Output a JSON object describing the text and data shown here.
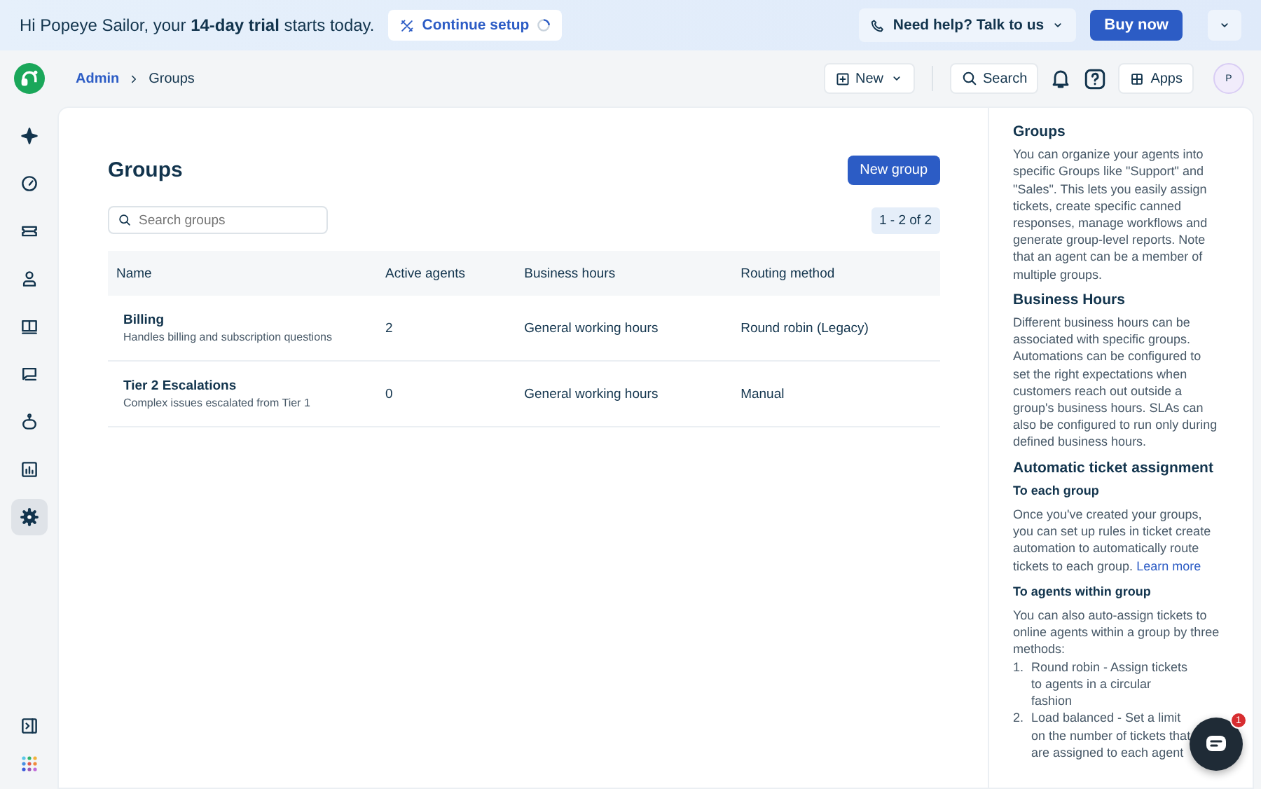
{
  "banner": {
    "greeting": "Hi Popeye Sailor, your **14-day trial** starts today.",
    "setup_button": "Continue setup",
    "help_button": "Need help? Talk to us",
    "buy_button": "Buy now"
  },
  "breadcrumb": {
    "parent": "Admin",
    "current": "Groups"
  },
  "header_actions": {
    "new_button": "New",
    "search_button": "Search",
    "apps_button": "Apps",
    "avatar": "P"
  },
  "sidebar": {
    "items": [
      {
        "selected": false
      },
      {
        "selected": false
      },
      {
        "selected": false
      },
      {
        "selected": false
      },
      {
        "selected": false
      },
      {
        "selected": false
      },
      {
        "selected": false
      },
      {
        "selected": false
      },
      {
        "selected": true
      }
    ]
  },
  "page": {
    "title": "Groups",
    "new_group_button": "New group",
    "search": {
      "placeholder": "Search groups"
    },
    "pagination": "1 - 2 of 2"
  },
  "table": {
    "columns": [
      "Name",
      "Active agents",
      "Business hours",
      "Routing method"
    ],
    "rows": [
      {
        "name": "Billing",
        "description": "Handles billing and subscription questions",
        "active_agents": "2",
        "business_hours": "General working hours",
        "routing_method": "Round robin (Legacy)"
      },
      {
        "name": "Tier 2 Escalations",
        "description": "Complex issues escalated from Tier 1",
        "active_agents": "0",
        "business_hours": "General working hours",
        "routing_method": "Manual"
      }
    ]
  },
  "help_panel": {
    "sections": [
      {
        "kind": "heading",
        "text": "Groups"
      },
      {
        "kind": "paragraph",
        "text": "You can organize your agents into specific Groups like \"Support\" and \"Sales\". This lets you easily assign tickets, create specific canned responses, manage workflows and generate group-level reports. Note that an agent can be a member of multiple groups."
      },
      {
        "kind": "heading",
        "text": "Business Hours"
      },
      {
        "kind": "paragraph",
        "text": "Different business hours can be associated with specific groups. Automations can be configured to set the right expectations when customers reach out outside a group's business hours. SLAs can also be configured to run only during defined business hours."
      },
      {
        "kind": "heading",
        "text": "Automatic ticket assignment"
      },
      {
        "kind": "subheading",
        "text": "To each group"
      },
      {
        "kind": "paragraph",
        "text": "Once you've created your groups, you can set up rules in ticket create automation to automatically route tickets to each group.",
        "link": "Learn more"
      },
      {
        "kind": "subheading",
        "text": "To agents within group"
      },
      {
        "kind": "paragraph",
        "text": "You can also auto-assign tickets to online agents within a group by three methods:"
      },
      {
        "kind": "list",
        "items": [
          {
            "marker": "1.",
            "text": "Round robin - Assign tickets to agents in a circular fashion"
          },
          {
            "marker": "2.",
            "text": "Load balanced - Set a limit on the number of tickets that are assigned to each agent"
          }
        ]
      }
    ]
  },
  "chat_badge": "1"
}
